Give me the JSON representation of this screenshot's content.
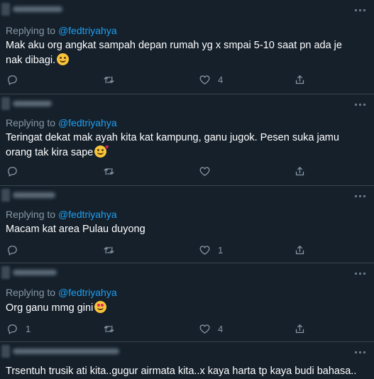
{
  "colors": {
    "background": "#15202b",
    "divider": "#38444d",
    "muted": "#8899a6",
    "link": "#1da1f2"
  },
  "icons": {
    "reply": "reply-icon",
    "retweet": "retweet-icon",
    "like": "heart-icon",
    "share": "share-icon",
    "more": "more-icon"
  },
  "tweets": [
    {
      "replying_prefix": "Replying to",
      "handle": "@fedtriyahya",
      "text": "Mak aku org angkat sampah depan rumah yg x smpai 5-10 saat pn ada je nak dibagi.",
      "emoji": "smiling-face-emoji",
      "reply_count": "",
      "retweet_count": "",
      "like_count": "4"
    },
    {
      "replying_prefix": "Replying to",
      "handle": "@fedtriyahya",
      "text": "Teringat dekat mak ayah kita kat kampung, ganu jugok. Pesen suka jamu orang tak kira sape",
      "emoji": "smiling-face-with-hearts-emoji",
      "reply_count": "",
      "retweet_count": "",
      "like_count": ""
    },
    {
      "replying_prefix": "Replying to",
      "handle": "@fedtriyahya",
      "text": "Macam kat area Pulau duyong",
      "emoji": "",
      "reply_count": "",
      "retweet_count": "",
      "like_count": "1"
    },
    {
      "replying_prefix": "Replying to",
      "handle": "@fedtriyahya",
      "text": "Org ganu mmg gini",
      "emoji": "heart-eyes-emoji",
      "reply_count": "1",
      "retweet_count": "",
      "like_count": "4"
    },
    {
      "text": "Trsentuh trusik ati kita..gugur airmata kita..x kaya harta tp kaya budi bahasa.."
    }
  ]
}
